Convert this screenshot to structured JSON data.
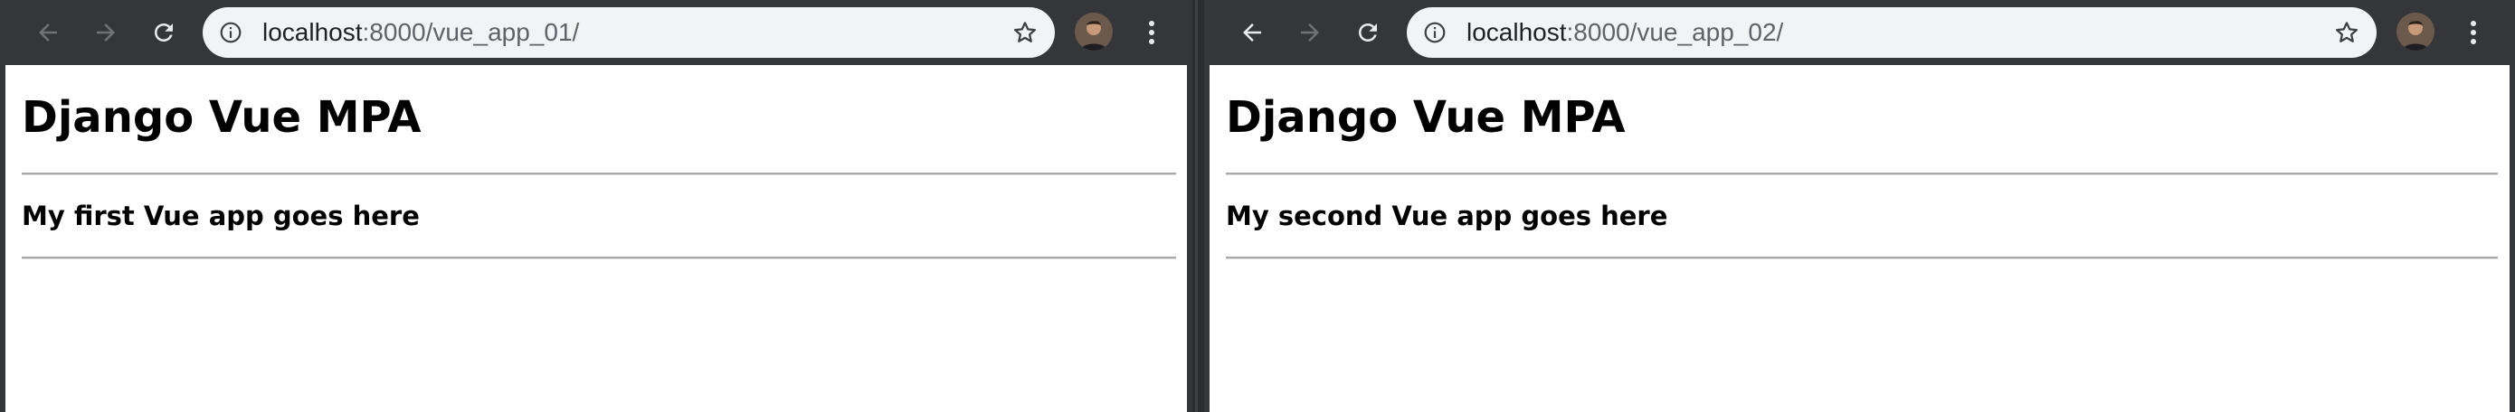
{
  "windows": [
    {
      "url_host": "localhost",
      "url_rest": ":8000/vue_app_01/",
      "page_title": "Django Vue MPA",
      "app_text": "My first Vue app goes here"
    },
    {
      "url_host": "localhost",
      "url_rest": ":8000/vue_app_02/",
      "page_title": "Django Vue MPA",
      "app_text": "My second Vue app goes here"
    }
  ],
  "icons": {
    "back": "arrow-left-icon",
    "forward": "arrow-right-icon",
    "reload": "reload-icon",
    "info": "info-icon",
    "bookmark": "star-icon",
    "profile": "avatar",
    "menu": "kebab-menu-icon"
  },
  "colors": {
    "toolbar": "#35363a",
    "omnibox": "#f1f3f4",
    "icon_active": "#e8eaed",
    "icon_disabled": "#6f7276",
    "page_background": "#ffffff",
    "rule": "#a9a9a9"
  }
}
